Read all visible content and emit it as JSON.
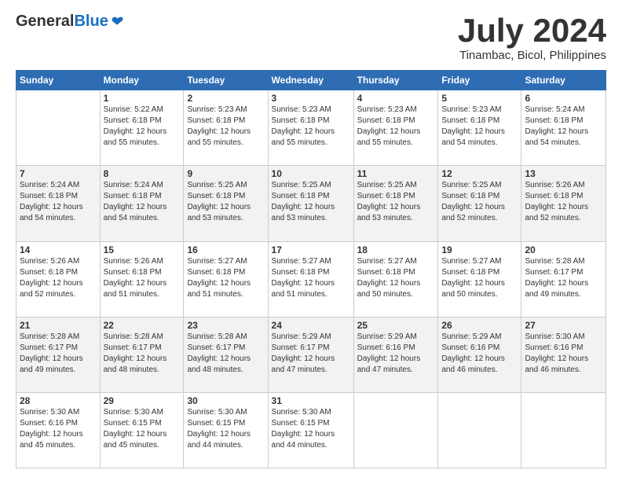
{
  "header": {
    "logo_general": "General",
    "logo_blue": "Blue",
    "month": "July 2024",
    "location": "Tinambac, Bicol, Philippines"
  },
  "days_of_week": [
    "Sunday",
    "Monday",
    "Tuesday",
    "Wednesday",
    "Thursday",
    "Friday",
    "Saturday"
  ],
  "weeks": [
    [
      {
        "day": "",
        "sunrise": "",
        "sunset": "",
        "daylight": ""
      },
      {
        "day": "1",
        "sunrise": "Sunrise: 5:22 AM",
        "sunset": "Sunset: 6:18 PM",
        "daylight": "Daylight: 12 hours and 55 minutes."
      },
      {
        "day": "2",
        "sunrise": "Sunrise: 5:23 AM",
        "sunset": "Sunset: 6:18 PM",
        "daylight": "Daylight: 12 hours and 55 minutes."
      },
      {
        "day": "3",
        "sunrise": "Sunrise: 5:23 AM",
        "sunset": "Sunset: 6:18 PM",
        "daylight": "Daylight: 12 hours and 55 minutes."
      },
      {
        "day": "4",
        "sunrise": "Sunrise: 5:23 AM",
        "sunset": "Sunset: 6:18 PM",
        "daylight": "Daylight: 12 hours and 55 minutes."
      },
      {
        "day": "5",
        "sunrise": "Sunrise: 5:23 AM",
        "sunset": "Sunset: 6:18 PM",
        "daylight": "Daylight: 12 hours and 54 minutes."
      },
      {
        "day": "6",
        "sunrise": "Sunrise: 5:24 AM",
        "sunset": "Sunset: 6:18 PM",
        "daylight": "Daylight: 12 hours and 54 minutes."
      }
    ],
    [
      {
        "day": "7",
        "sunrise": "Sunrise: 5:24 AM",
        "sunset": "Sunset: 6:18 PM",
        "daylight": "Daylight: 12 hours and 54 minutes."
      },
      {
        "day": "8",
        "sunrise": "Sunrise: 5:24 AM",
        "sunset": "Sunset: 6:18 PM",
        "daylight": "Daylight: 12 hours and 54 minutes."
      },
      {
        "day": "9",
        "sunrise": "Sunrise: 5:25 AM",
        "sunset": "Sunset: 6:18 PM",
        "daylight": "Daylight: 12 hours and 53 minutes."
      },
      {
        "day": "10",
        "sunrise": "Sunrise: 5:25 AM",
        "sunset": "Sunset: 6:18 PM",
        "daylight": "Daylight: 12 hours and 53 minutes."
      },
      {
        "day": "11",
        "sunrise": "Sunrise: 5:25 AM",
        "sunset": "Sunset: 6:18 PM",
        "daylight": "Daylight: 12 hours and 53 minutes."
      },
      {
        "day": "12",
        "sunrise": "Sunrise: 5:25 AM",
        "sunset": "Sunset: 6:18 PM",
        "daylight": "Daylight: 12 hours and 52 minutes."
      },
      {
        "day": "13",
        "sunrise": "Sunrise: 5:26 AM",
        "sunset": "Sunset: 6:18 PM",
        "daylight": "Daylight: 12 hours and 52 minutes."
      }
    ],
    [
      {
        "day": "14",
        "sunrise": "Sunrise: 5:26 AM",
        "sunset": "Sunset: 6:18 PM",
        "daylight": "Daylight: 12 hours and 52 minutes."
      },
      {
        "day": "15",
        "sunrise": "Sunrise: 5:26 AM",
        "sunset": "Sunset: 6:18 PM",
        "daylight": "Daylight: 12 hours and 51 minutes."
      },
      {
        "day": "16",
        "sunrise": "Sunrise: 5:27 AM",
        "sunset": "Sunset: 6:18 PM",
        "daylight": "Daylight: 12 hours and 51 minutes."
      },
      {
        "day": "17",
        "sunrise": "Sunrise: 5:27 AM",
        "sunset": "Sunset: 6:18 PM",
        "daylight": "Daylight: 12 hours and 51 minutes."
      },
      {
        "day": "18",
        "sunrise": "Sunrise: 5:27 AM",
        "sunset": "Sunset: 6:18 PM",
        "daylight": "Daylight: 12 hours and 50 minutes."
      },
      {
        "day": "19",
        "sunrise": "Sunrise: 5:27 AM",
        "sunset": "Sunset: 6:18 PM",
        "daylight": "Daylight: 12 hours and 50 minutes."
      },
      {
        "day": "20",
        "sunrise": "Sunrise: 5:28 AM",
        "sunset": "Sunset: 6:17 PM",
        "daylight": "Daylight: 12 hours and 49 minutes."
      }
    ],
    [
      {
        "day": "21",
        "sunrise": "Sunrise: 5:28 AM",
        "sunset": "Sunset: 6:17 PM",
        "daylight": "Daylight: 12 hours and 49 minutes."
      },
      {
        "day": "22",
        "sunrise": "Sunrise: 5:28 AM",
        "sunset": "Sunset: 6:17 PM",
        "daylight": "Daylight: 12 hours and 48 minutes."
      },
      {
        "day": "23",
        "sunrise": "Sunrise: 5:28 AM",
        "sunset": "Sunset: 6:17 PM",
        "daylight": "Daylight: 12 hours and 48 minutes."
      },
      {
        "day": "24",
        "sunrise": "Sunrise: 5:29 AM",
        "sunset": "Sunset: 6:17 PM",
        "daylight": "Daylight: 12 hours and 47 minutes."
      },
      {
        "day": "25",
        "sunrise": "Sunrise: 5:29 AM",
        "sunset": "Sunset: 6:16 PM",
        "daylight": "Daylight: 12 hours and 47 minutes."
      },
      {
        "day": "26",
        "sunrise": "Sunrise: 5:29 AM",
        "sunset": "Sunset: 6:16 PM",
        "daylight": "Daylight: 12 hours and 46 minutes."
      },
      {
        "day": "27",
        "sunrise": "Sunrise: 5:30 AM",
        "sunset": "Sunset: 6:16 PM",
        "daylight": "Daylight: 12 hours and 46 minutes."
      }
    ],
    [
      {
        "day": "28",
        "sunrise": "Sunrise: 5:30 AM",
        "sunset": "Sunset: 6:16 PM",
        "daylight": "Daylight: 12 hours and 45 minutes."
      },
      {
        "day": "29",
        "sunrise": "Sunrise: 5:30 AM",
        "sunset": "Sunset: 6:15 PM",
        "daylight": "Daylight: 12 hours and 45 minutes."
      },
      {
        "day": "30",
        "sunrise": "Sunrise: 5:30 AM",
        "sunset": "Sunset: 6:15 PM",
        "daylight": "Daylight: 12 hours and 44 minutes."
      },
      {
        "day": "31",
        "sunrise": "Sunrise: 5:30 AM",
        "sunset": "Sunset: 6:15 PM",
        "daylight": "Daylight: 12 hours and 44 minutes."
      },
      {
        "day": "",
        "sunrise": "",
        "sunset": "",
        "daylight": ""
      },
      {
        "day": "",
        "sunrise": "",
        "sunset": "",
        "daylight": ""
      },
      {
        "day": "",
        "sunrise": "",
        "sunset": "",
        "daylight": ""
      }
    ]
  ]
}
